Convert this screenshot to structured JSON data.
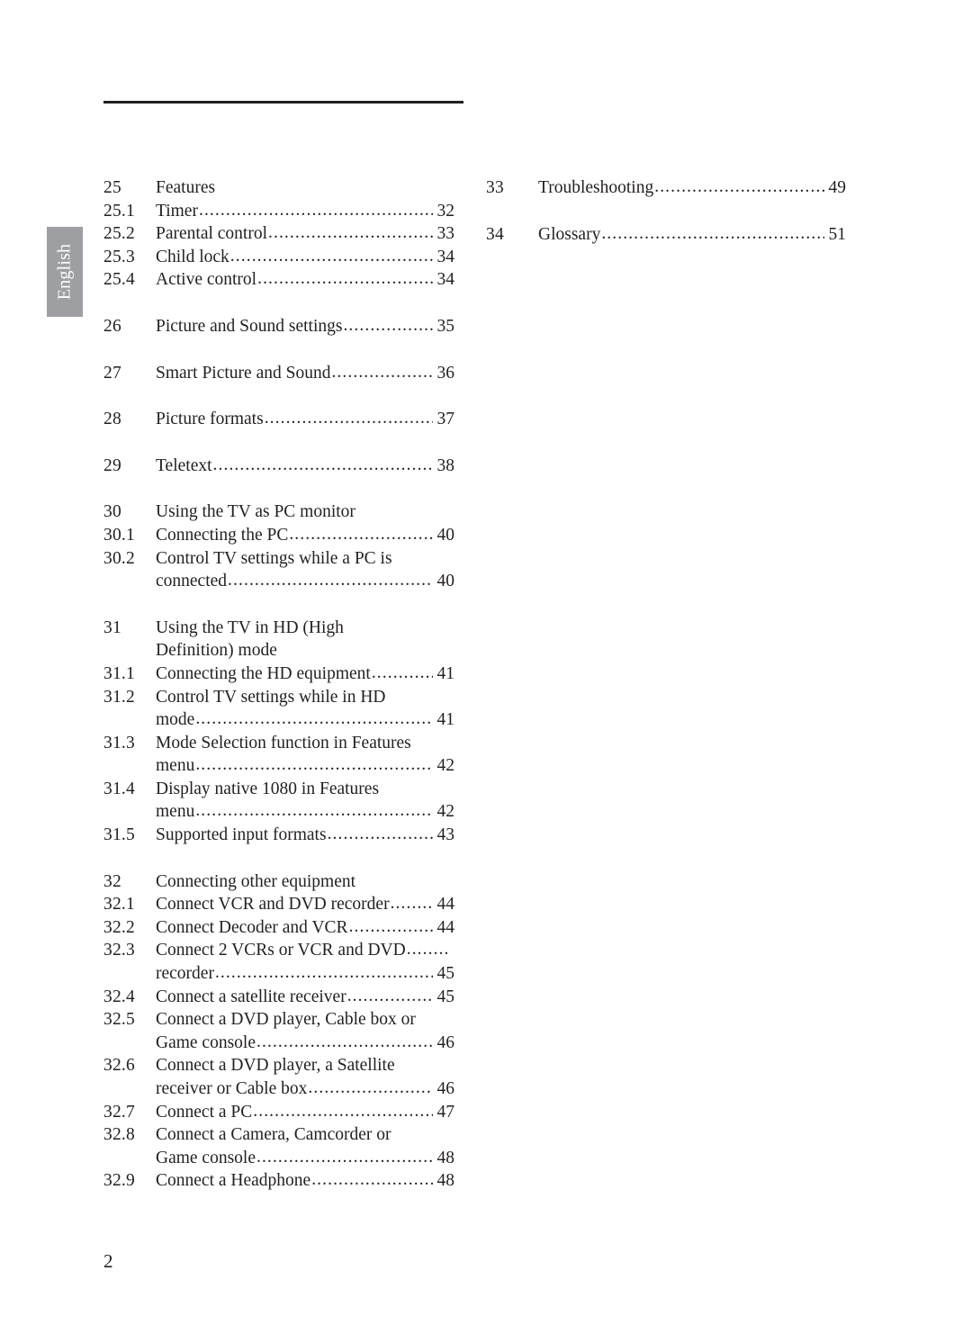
{
  "document": {
    "side_tab_label": "English",
    "folio": "2",
    "leader_char": "."
  },
  "toc": {
    "left_column": [
      {
        "kind": "head",
        "num": "25",
        "title": "Features",
        "leader": false,
        "page": ""
      },
      {
        "kind": "sub",
        "num": "25.1",
        "title": "Timer",
        "leader": true,
        "page": "32"
      },
      {
        "kind": "sub",
        "num": "25.2",
        "title": "Parental control",
        "leader": true,
        "page": "33"
      },
      {
        "kind": "sub",
        "num": "25.3",
        "title": "Child lock",
        "leader": true,
        "page": "34"
      },
      {
        "kind": "sub",
        "num": "25.4",
        "title": "Active control",
        "leader": true,
        "page": "34"
      },
      {
        "kind": "gap"
      },
      {
        "kind": "head",
        "num": "26",
        "title": "Picture and Sound settings",
        "leader": true,
        "page": "35"
      },
      {
        "kind": "gap"
      },
      {
        "kind": "head",
        "num": "27",
        "title": "Smart Picture and Sound",
        "leader": true,
        "page": "36"
      },
      {
        "kind": "gap"
      },
      {
        "kind": "head",
        "num": "28",
        "title": "Picture formats",
        "leader": true,
        "page": "37"
      },
      {
        "kind": "gap"
      },
      {
        "kind": "head",
        "num": "29",
        "title": "Teletext",
        "leader": true,
        "page": "38"
      },
      {
        "kind": "gap"
      },
      {
        "kind": "head",
        "num": "30",
        "title": "Using the TV as PC monitor",
        "leader": false,
        "page": ""
      },
      {
        "kind": "sub",
        "num": "30.1",
        "title": "Connecting the PC",
        "leader": true,
        "page": "40"
      },
      {
        "kind": "sub",
        "num": "30.2",
        "title": "Control TV settings while a PC is",
        "leader": false,
        "page": ""
      },
      {
        "kind": "cont",
        "num": "30.2",
        "title": "connected",
        "leader": true,
        "page": "40"
      },
      {
        "kind": "gap"
      },
      {
        "kind": "head",
        "num": "31",
        "title": "Using the TV in HD (High",
        "leader": false,
        "page": ""
      },
      {
        "kind": "cont",
        "num": "31",
        "title": "Definition) mode",
        "leader": false,
        "page": ""
      },
      {
        "kind": "sub",
        "num": "31.1",
        "title": "Connecting the HD equipment",
        "leader": true,
        "page": "41"
      },
      {
        "kind": "sub",
        "num": "31.2",
        "title": "Control TV settings while in HD",
        "leader": false,
        "page": ""
      },
      {
        "kind": "cont",
        "num": "31.2",
        "title": "mode",
        "leader": true,
        "page": "41"
      },
      {
        "kind": "sub",
        "num": "31.3",
        "title": "Mode Selection function in Features",
        "leader": false,
        "page": ""
      },
      {
        "kind": "cont",
        "num": "31.3",
        "title": "menu",
        "leader": true,
        "page": "42"
      },
      {
        "kind": "sub",
        "num": "31.4",
        "title": "Display native 1080 in Features",
        "leader": false,
        "page": ""
      },
      {
        "kind": "cont",
        "num": "31.4",
        "title": "menu",
        "leader": true,
        "page": "42"
      },
      {
        "kind": "sub",
        "num": "31.5",
        "title": "Supported input formats",
        "leader": true,
        "page": "43"
      },
      {
        "kind": "gap"
      },
      {
        "kind": "head",
        "num": "32",
        "title": "Connecting other equipment",
        "leader": false,
        "page": ""
      },
      {
        "kind": "sub",
        "num": "32.1",
        "title": "Connect VCR and DVD recorder",
        "leader": true,
        "page": "44"
      },
      {
        "kind": "sub",
        "num": "32.2",
        "title": "Connect Decoder and VCR",
        "leader": true,
        "page": "44"
      },
      {
        "kind": "sub",
        "num": "32.3",
        "title": "Connect 2 VCRs or VCR and DVD",
        "leader": true,
        "page": ""
      },
      {
        "kind": "cont",
        "num": "32.3",
        "title": "recorder",
        "leader": true,
        "page": "45"
      },
      {
        "kind": "sub",
        "num": "32.4",
        "title": "Connect a satellite receiver",
        "leader": true,
        "page": "45"
      },
      {
        "kind": "sub",
        "num": "32.5",
        "title": "Connect a DVD player, Cable box or",
        "leader": false,
        "page": ""
      },
      {
        "kind": "cont",
        "num": "32.5",
        "title": "Game console",
        "leader": true,
        "page": "46"
      },
      {
        "kind": "sub",
        "num": "32.6",
        "title": "Connect a DVD player, a Satellite",
        "leader": false,
        "page": ""
      },
      {
        "kind": "cont",
        "num": "32.6",
        "title": "receiver or Cable box",
        "leader": true,
        "page": "46"
      },
      {
        "kind": "sub",
        "num": "32.7",
        "title": "Connect a PC",
        "leader": true,
        "page": "47"
      },
      {
        "kind": "sub",
        "num": "32.8",
        "title": "Connect a Camera, Camcorder or",
        "leader": false,
        "page": ""
      },
      {
        "kind": "cont",
        "num": "32.8",
        "title": "Game console",
        "leader": true,
        "page": "48"
      },
      {
        "kind": "sub",
        "num": "32.9",
        "title": "Connect a Headphone",
        "leader": true,
        "page": "48"
      }
    ],
    "right_column": [
      {
        "kind": "head",
        "num": "33",
        "title": "Troubleshooting",
        "leader": true,
        "page": "49"
      },
      {
        "kind": "gap"
      },
      {
        "kind": "head",
        "num": "34",
        "title": "Glossary",
        "leader": true,
        "page": "51"
      }
    ]
  }
}
